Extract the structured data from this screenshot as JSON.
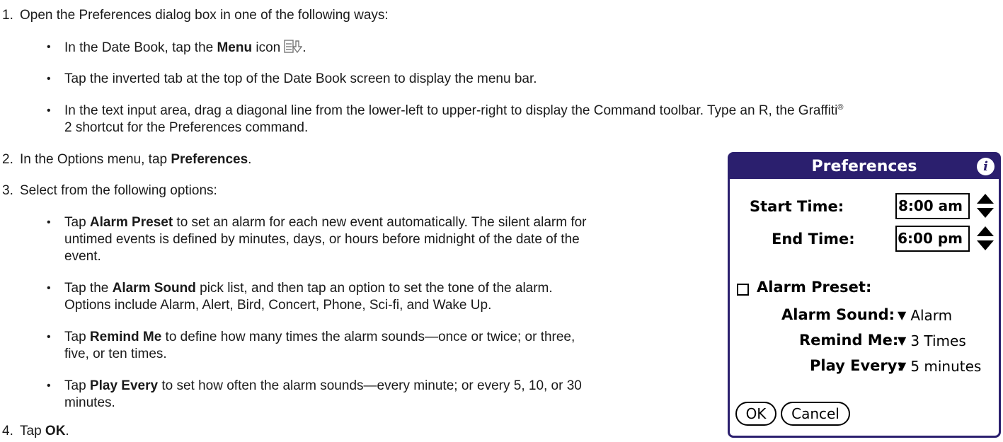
{
  "instructions": {
    "step1": {
      "number": "1.",
      "text": "Open the Preferences dialog box in one of the following ways:"
    },
    "step1_bullets": {
      "b1": {
        "pre": "In the Date Book, tap the ",
        "bold": "Menu",
        "post": " icon",
        "end": ".",
        "icon": "menu-icon"
      },
      "b2": {
        "text": "Tap the inverted tab at the top of the Date Book screen to display the menu bar."
      },
      "b3": {
        "line1": "In the text input area, drag a diagonal line from the lower-left to upper-right to display the Command toolbar. Type an R, the Graffiti",
        "reg": "®",
        "line2": "2 shortcut for the Preferences command."
      }
    },
    "step2": {
      "number": "2.",
      "pre": "In the Options menu, tap ",
      "bold": "Preferences",
      "post": "."
    },
    "step3": {
      "number": "3.",
      "text": "Select from the following options:"
    },
    "step3_bullets": {
      "b1": {
        "pre": "Tap ",
        "bold": "Alarm Preset",
        "post": " to set an alarm for each new event automatically. The silent alarm for",
        "line2": "untimed events is defined by minutes, days, or hours before midnight of the date of the",
        "line3": "event."
      },
      "b2": {
        "pre": "Tap the ",
        "bold": "Alarm Sound",
        "post": " pick list, and then tap an option to set the tone of the alarm.",
        "line2": "Options include Alarm, Alert, Bird, Concert, Phone, Sci-fi, and Wake Up."
      },
      "b3": {
        "pre": "Tap ",
        "bold": "Remind Me",
        "post": " to define how many times the alarm sounds—once or twice; or three,",
        "line2": "five, or ten times."
      },
      "b4": {
        "pre": "Tap ",
        "bold": "Play Every",
        "post": " to set how often the alarm sounds—every minute; or every 5, 10, or 30",
        "line2": "minutes."
      }
    },
    "step4": {
      "number": "4.",
      "pre": "Tap ",
      "bold": "OK",
      "post": "."
    }
  },
  "dialog": {
    "title": "Preferences",
    "info_icon_glyph": "i",
    "start_time": {
      "label": "Start Time:",
      "value": "8:00 am"
    },
    "end_time": {
      "label": "End Time:",
      "value": "6:00 pm"
    },
    "alarm_preset": {
      "label": "Alarm Preset:",
      "checked": false
    },
    "alarm_sound": {
      "label": "Alarm Sound:",
      "value": "Alarm"
    },
    "remind_me": {
      "label": "Remind Me:",
      "value": "3 Times"
    },
    "play_every": {
      "label": "Play Every:",
      "value": "5 minutes"
    },
    "ok_label": "OK",
    "cancel_label": "Cancel"
  },
  "colors": {
    "dialog_frame": "#2b1f6e",
    "text": "#1a1a1a"
  }
}
